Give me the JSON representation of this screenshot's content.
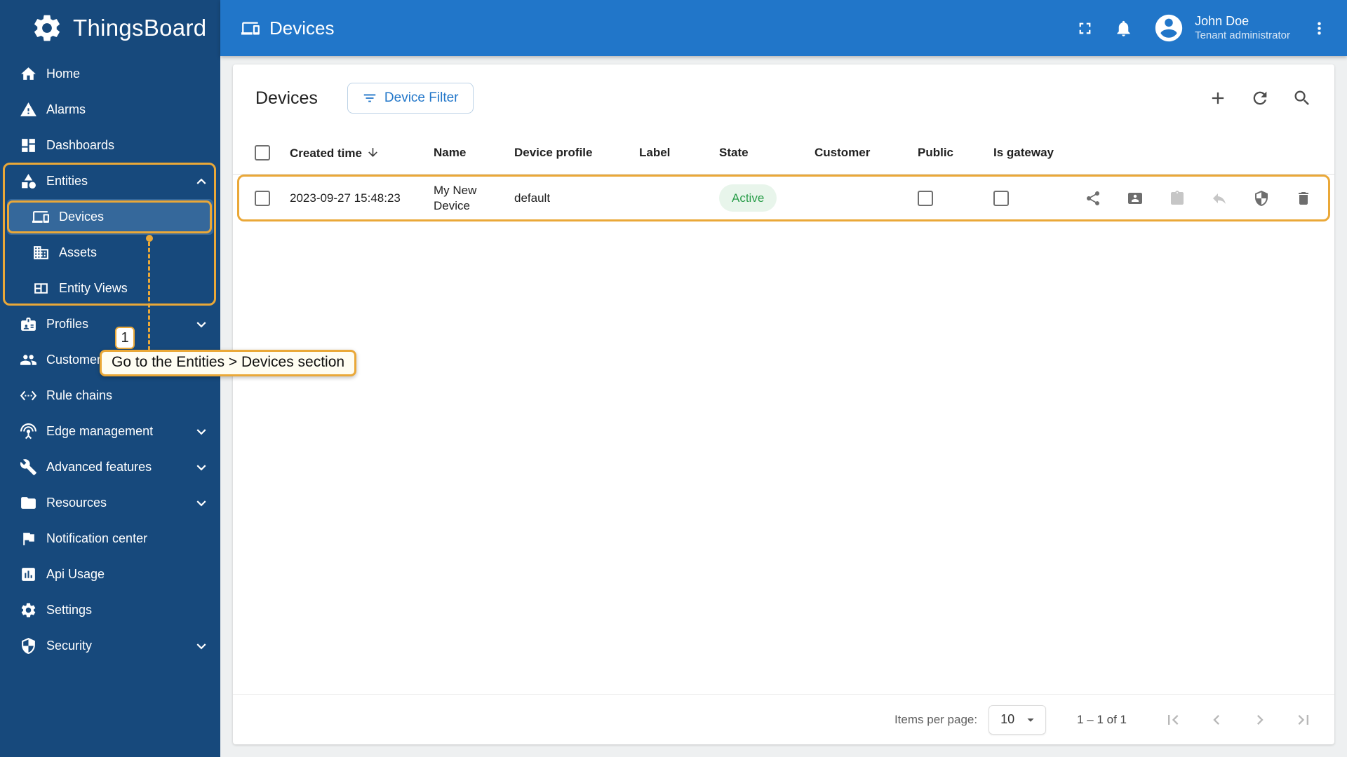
{
  "colors": {
    "accent": "#eaa838",
    "sidebar": "#17497c",
    "topbar": "#2176c9",
    "selected_nav": "#35689b",
    "state_active_text": "#2a9d4a",
    "state_active_bg": "#e8f5eb"
  },
  "brand": {
    "name": "ThingsBoard",
    "icon": "gear-logo"
  },
  "topbar": {
    "title": "Devices",
    "icon": "devices",
    "icons": [
      "fullscreen",
      "notifications-bell",
      "avatar",
      "more-vert"
    ],
    "user": {
      "name": "John Doe",
      "role": "Tenant administrator"
    }
  },
  "sidebar": {
    "items": [
      {
        "label": "Home",
        "icon": "home"
      },
      {
        "label": "Alarms",
        "icon": "warning-triangle"
      },
      {
        "label": "Dashboards",
        "icon": "dashboard-grid"
      },
      {
        "label": "Entities",
        "icon": "category",
        "expanded": true
      },
      {
        "label": "Devices",
        "icon": "devices",
        "selected": true,
        "sub": true
      },
      {
        "label": "Assets",
        "icon": "domain-building",
        "sub": true
      },
      {
        "label": "Entity Views",
        "icon": "view-quilt",
        "sub": true
      },
      {
        "label": "Profiles",
        "icon": "badge",
        "expandable": true
      },
      {
        "label": "Customers",
        "icon": "people"
      },
      {
        "label": "Rule chains",
        "icon": "settings-ethernet"
      },
      {
        "label": "Edge management",
        "icon": "antenna",
        "expandable": true
      },
      {
        "label": "Advanced features",
        "icon": "wrench",
        "expandable": true
      },
      {
        "label": "Resources",
        "icon": "folder",
        "expandable": true
      },
      {
        "label": "Notification center",
        "icon": "flag"
      },
      {
        "label": "Api Usage",
        "icon": "bar-chart",
        "expandable": true
      },
      {
        "label": "Settings",
        "icon": "gear"
      },
      {
        "label": "Security",
        "icon": "shield",
        "expandable": true
      }
    ]
  },
  "main": {
    "title": "Devices",
    "filter_button_label": "Device Filter",
    "toolbar_icons": [
      "add",
      "refresh",
      "search"
    ],
    "table": {
      "headers": {
        "created_time": "Created time",
        "name": "Name",
        "device_profile": "Device profile",
        "label": "Label",
        "state": "State",
        "customer": "Customer",
        "public": "Public",
        "is_gateway": "Is gateway"
      },
      "sorted_by": "created_time",
      "sort_direction": "desc",
      "rows": [
        {
          "created_time": "2023-09-27 15:48:23",
          "name": "My New Device",
          "device_profile": "default",
          "label": "",
          "state": "Active",
          "customer": "",
          "public": false,
          "is_gateway": false
        }
      ],
      "row_actions": [
        {
          "name": "share",
          "disabled": false
        },
        {
          "name": "assign-to-customer",
          "disabled": false
        },
        {
          "name": "make-public",
          "disabled": true
        },
        {
          "name": "unassign-from-customer",
          "disabled": true
        },
        {
          "name": "manage-credentials",
          "disabled": false
        },
        {
          "name": "delete",
          "disabled": false
        }
      ]
    },
    "pagination": {
      "items_per_page_label": "Items per page:",
      "page_size": "10",
      "range_label": "1 – 1 of 1",
      "nav_icons": [
        "first-page",
        "prev-page",
        "next-page",
        "last-page"
      ]
    }
  },
  "annotation": {
    "step": "1",
    "tooltip": "Go to the Entities > Devices section"
  }
}
